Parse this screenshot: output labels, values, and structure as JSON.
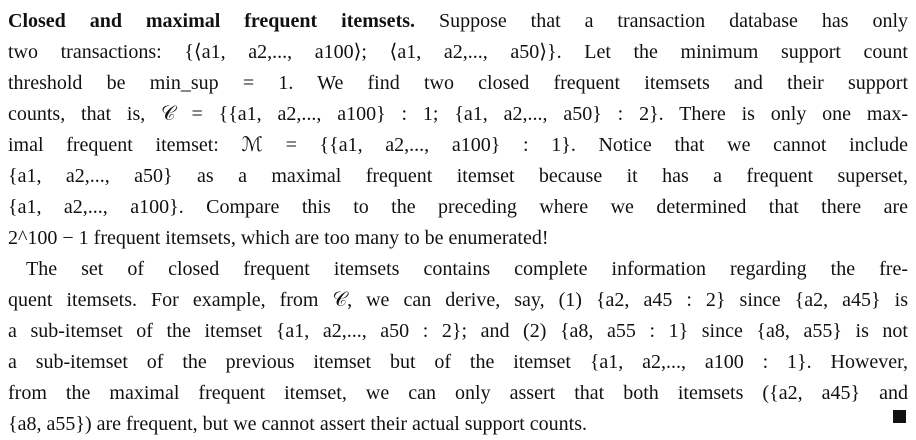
{
  "section": {
    "heading": "Closed and maximal frequent itemsets.",
    "para1_lines": [
      " Suppose that a transaction database has only",
      "two transactions: {⟨a1, a2,..., a100⟩; ⟨a1, a2,..., a50⟩}. Let the minimum support count",
      "threshold be min_sup = 1. We find two closed frequent itemsets and their support",
      "counts, that is, 𝒞 = {{a1, a2,..., a100} : 1; {a1, a2,..., a50} : 2}. There is only one max-",
      "imal frequent itemset: ℳ = {{a1, a2,..., a100} : 1}. Notice that we cannot include",
      "{a1, a2,..., a50} as a maximal frequent itemset because it has a frequent superset,",
      "{a1, a2,..., a100}. Compare this to the preceding where we determined that there are",
      "2^100 − 1 frequent itemsets, which are too many to be enumerated!"
    ],
    "para2_lines": [
      "The set of closed frequent itemsets contains complete information regarding the fre-",
      "quent itemsets. For example, from 𝒞, we can derive, say, (1) {a2, a45 : 2} since {a2, a45} is",
      "a sub-itemset of the itemset {a1, a2,..., a50 : 2}; and (2) {a8, a55 : 1} since {a8, a55} is not",
      "a sub-itemset of the previous itemset but of the itemset {a1, a2,..., a100 : 1}. However,",
      "from the maximal frequent itemset, we can only assert that both itemsets ({a2, a45} and",
      "{a8, a55}) are frequent, but we cannot assert their actual support counts."
    ]
  }
}
